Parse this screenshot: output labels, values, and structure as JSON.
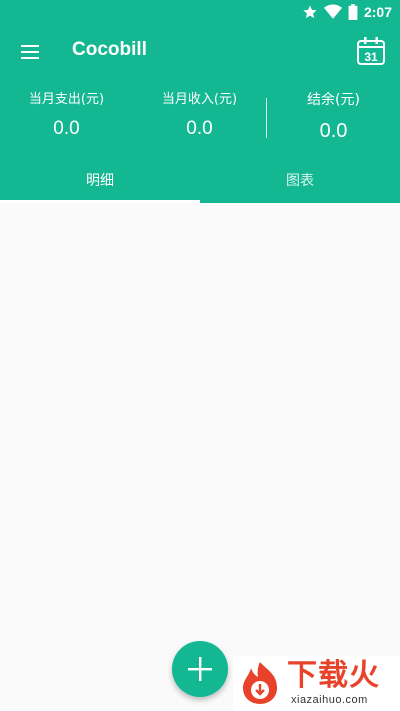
{
  "status_bar": {
    "time": "2:07",
    "icons": [
      "star-icon",
      "wifi-icon",
      "battery-icon"
    ]
  },
  "app_bar": {
    "title": "Cocobill",
    "menu_icon": "hamburger-menu-icon",
    "calendar_icon": "calendar-icon",
    "calendar_day": "31"
  },
  "summary": {
    "expense_label": "当月支出(元)",
    "expense_value": "0.0",
    "income_label": "当月收入(元)",
    "income_value": "0.0",
    "balance_label": "结余(元)",
    "balance_value": "0.0"
  },
  "tabs": [
    {
      "label": "明细",
      "selected": true
    },
    {
      "label": "图表",
      "selected": false
    }
  ],
  "fab": {
    "icon": "plus-icon"
  },
  "watermark": {
    "title": "下载火",
    "url": "xiazaihuo.com"
  },
  "colors": {
    "primary": "#13b892",
    "background": "#fafafa",
    "watermark": "#e8422a"
  }
}
